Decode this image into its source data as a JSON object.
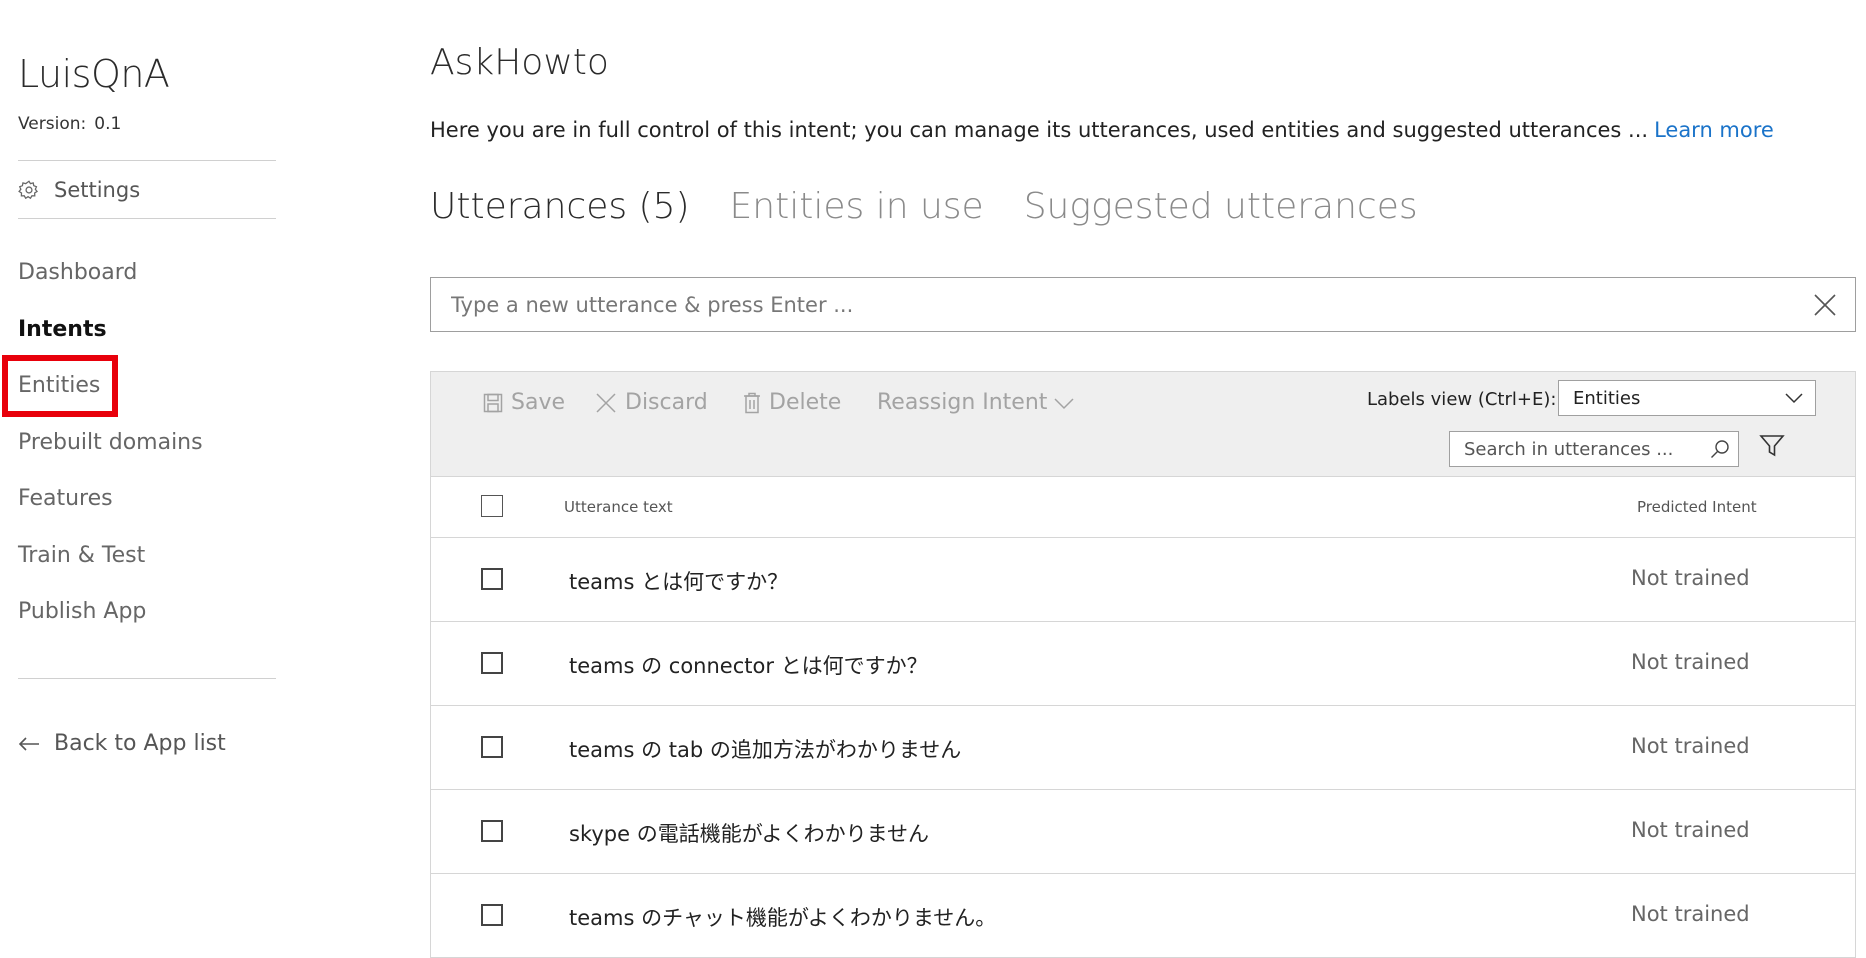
{
  "app": {
    "name": "LuisQnA",
    "version_label": "Version:",
    "version": "0.1"
  },
  "sidebar": {
    "settings_label": "Settings",
    "items": [
      {
        "label": "Dashboard"
      },
      {
        "label": "Intents"
      },
      {
        "label": "Entities"
      },
      {
        "label": "Prebuilt domains"
      },
      {
        "label": "Features"
      },
      {
        "label": "Train & Test"
      },
      {
        "label": "Publish App"
      }
    ],
    "back_label": "Back to App list",
    "active_item": "Intents",
    "highlighted_item": "Entities",
    "highlight_color": "#e8000b"
  },
  "main": {
    "title": "AskHowto",
    "description": "Here you are in full control of this intent; you can manage its utterances, used entities and suggested utterances ...",
    "learn_more": "Learn more",
    "tabs": [
      {
        "label": "Utterances (5)"
      },
      {
        "label": "Entities in use"
      },
      {
        "label": "Suggested utterances"
      }
    ],
    "active_tab": "Utterances (5)",
    "utterance_placeholder": "Type a new utterance & press Enter ...",
    "toolbar": {
      "save": "Save",
      "discard": "Discard",
      "delete": "Delete",
      "reassign": "Reassign Intent",
      "labels_view_label": "Labels view (Ctrl+E):",
      "labels_view_value": "Entities",
      "search_placeholder": "Search in utterances ..."
    },
    "table": {
      "columns": {
        "utterance": "Utterance text",
        "predicted": "Predicted Intent"
      },
      "rows": [
        {
          "text": "teams とは何ですか？",
          "predicted": "Not trained"
        },
        {
          "text": "teams の connector とは何ですか？",
          "predicted": "Not trained"
        },
        {
          "text": "teams の tab の追加方法がわかりません",
          "predicted": "Not trained"
        },
        {
          "text": "skype の電話機能がよくわかりません",
          "predicted": "Not trained"
        },
        {
          "text": "teams のチャット機能がよくわかりません。",
          "predicted": "Not trained"
        }
      ]
    }
  },
  "colors": {
    "link": "#1a73c9",
    "toolbar_bg": "#efefef",
    "highlight": "#e8000b"
  }
}
